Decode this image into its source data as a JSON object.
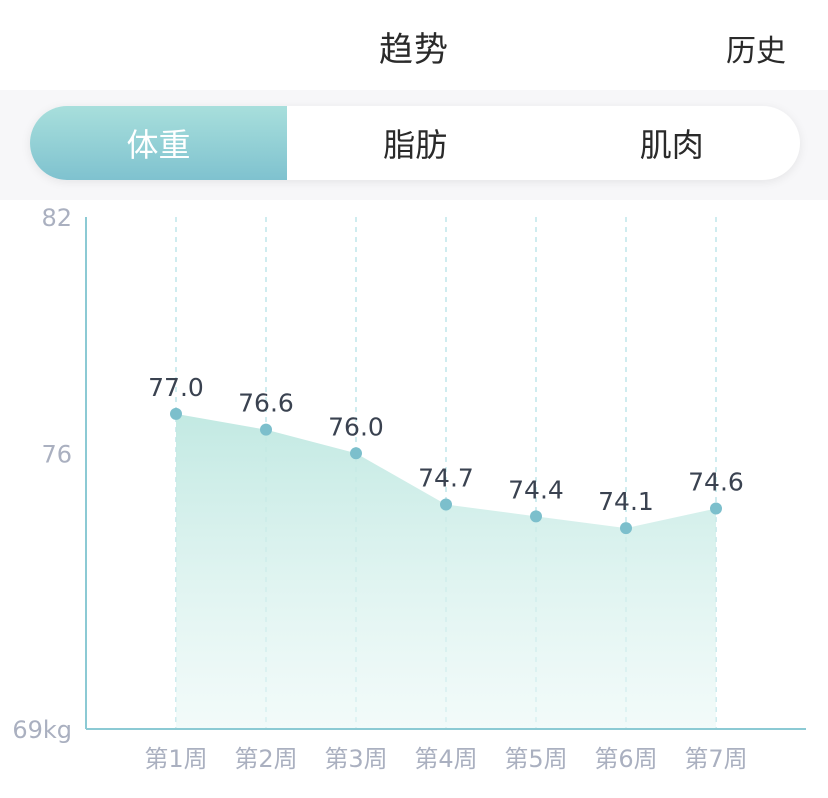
{
  "header": {
    "title": "趋势",
    "history_label": "历史"
  },
  "tabs": [
    {
      "label": "体重",
      "active": true
    },
    {
      "label": "脂肪",
      "active": false
    },
    {
      "label": "肌肉",
      "active": false
    }
  ],
  "colors": {
    "accent": "#7fc2cf",
    "accent_light": "#a8dfdc",
    "point": "#7cbfcc",
    "area_top": "#bfe8e1",
    "axis_label": "#aab0c0"
  },
  "chart_data": {
    "type": "area",
    "categories": [
      "第1周",
      "第2周",
      "第3周",
      "第4周",
      "第5周",
      "第6周",
      "第7周"
    ],
    "values": [
      77.0,
      76.6,
      76.0,
      74.7,
      74.4,
      74.1,
      74.6
    ],
    "value_labels": [
      "77.0",
      "76.6",
      "76.0",
      "74.7",
      "74.4",
      "74.1",
      "74.6"
    ],
    "ylim": [
      69,
      82
    ],
    "y_ticks": [
      "82",
      "76",
      "69kg"
    ],
    "y_tick_values": [
      82,
      76,
      69
    ],
    "grid": "vertical-dashed"
  }
}
